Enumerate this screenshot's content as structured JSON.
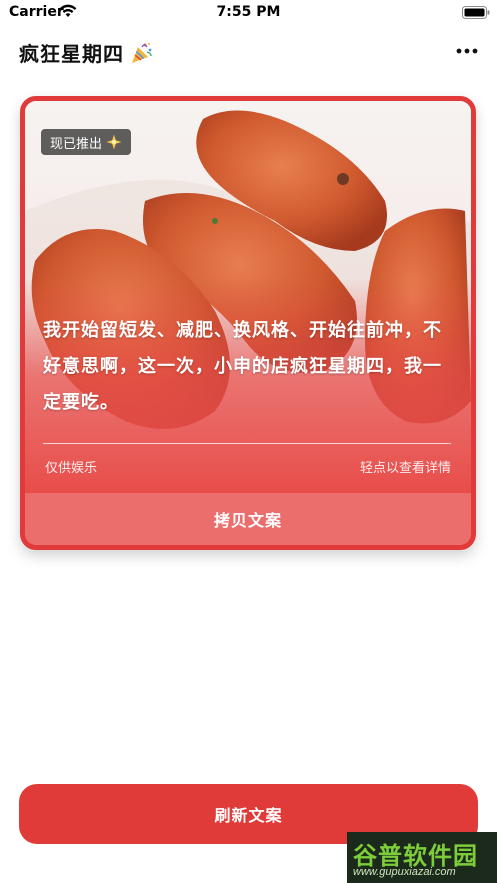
{
  "status_bar": {
    "carrier": "Carrier",
    "time": "7:55 PM"
  },
  "nav": {
    "title": "疯狂星期四",
    "title_icon": "party-popper-icon",
    "more_icon": "more-horizontal-icon"
  },
  "card": {
    "badge": "现已推出",
    "badge_icon": "sparkle-icon",
    "copy_text": "我开始留短发、减肥、换风格、开始往前冲，不好意思啊，这一次，小申的店疯狂星期四，我一定要吃。",
    "footnote_left": "仅供娱乐",
    "footnote_right": "轻点以查看详情",
    "copy_button": "拷贝文案"
  },
  "refresh_button": "刷新文案",
  "watermark": {
    "main": "谷普软件园",
    "url": "www.gupuxiazai.com"
  },
  "colors": {
    "accent": "#e03b39",
    "card_background": "#e84d4a",
    "copy_button": "#eb6e6c",
    "badge": "#3c3c3c"
  }
}
